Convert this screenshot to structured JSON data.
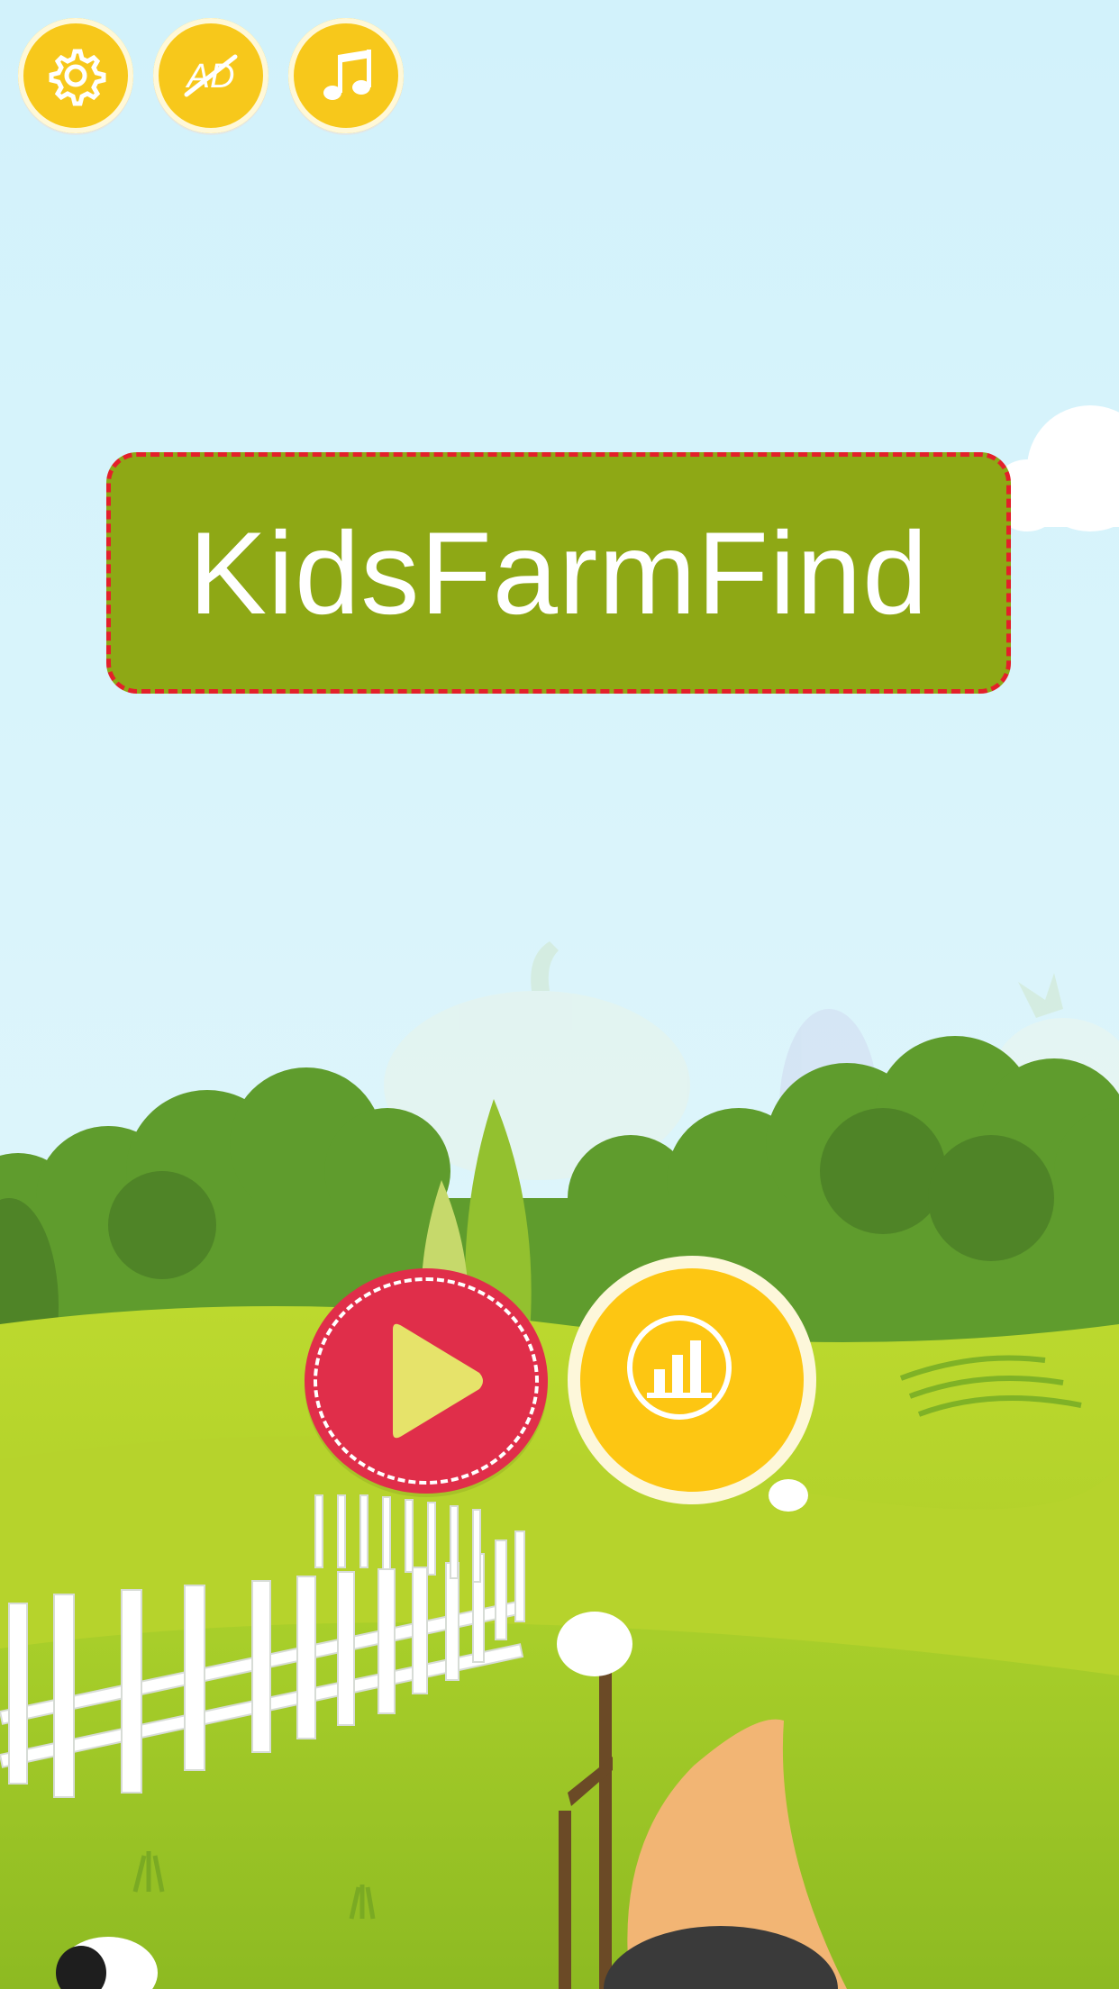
{
  "game": {
    "title": "KidsFarmFind"
  },
  "toolbar": {
    "buttons": [
      {
        "icon": "gear-icon"
      },
      {
        "icon": "no-ads-icon",
        "label": "AD"
      },
      {
        "icon": "music-note-icon"
      }
    ]
  },
  "menu": {
    "play_icon": "play-icon",
    "leaderboard_icon": "bar-chart-icon"
  },
  "colors": {
    "sky": "#d6f3fb",
    "title_bg": "#8ea815",
    "title_border": "#e3202a",
    "play": "#e02e4a",
    "yellow": "#f7c81b",
    "grass": "#b2cf2a"
  }
}
